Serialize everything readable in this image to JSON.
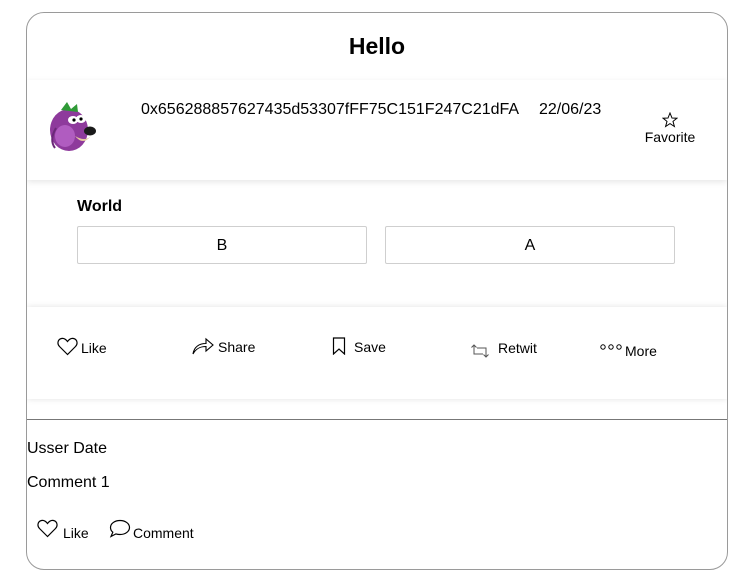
{
  "post": {
    "title": "Hello",
    "address": "0x656288857627435d53307fFF75C151F247C21dFA",
    "date": "22/06/23",
    "favorite_label": "Favorite",
    "poll": {
      "question": "World",
      "options": [
        "B",
        "A"
      ]
    },
    "actions": {
      "like": "Like",
      "share": "Share",
      "save": "Save",
      "retweet": "Retwit",
      "more": "More"
    }
  },
  "comments": [
    {
      "meta": "Usser Date",
      "text": "Comment 1",
      "like_label": "Like",
      "comment_label": "Comment"
    }
  ],
  "icons": {
    "avatar": "purple-cartoon-dog-avatar",
    "favorite": "star-outline-icon",
    "like": "heart-outline-icon",
    "share": "share-arrow-icon",
    "save": "bookmark-icon",
    "retweet": "retweet-icon",
    "more": "three-dots-icon",
    "comment": "speech-bubble-icon"
  },
  "colors": {
    "border": "#9a9a9a",
    "avatar_purple": "#8e3a9c"
  }
}
